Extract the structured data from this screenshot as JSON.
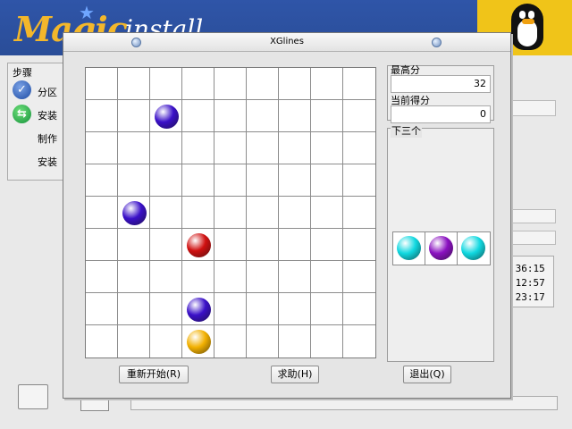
{
  "installer": {
    "logo_text": "Magic",
    "logo_rest": "install",
    "steps_title": "步骤",
    "steps": [
      {
        "label": "分区",
        "icon": "check-icon"
      },
      {
        "label": "安装",
        "icon": "arrows-icon"
      },
      {
        "label": "制作",
        "icon": ""
      },
      {
        "label": "安装",
        "icon": ""
      }
    ],
    "times": [
      ":36:15",
      ":12:57",
      ":23:17"
    ]
  },
  "dialog": {
    "title": "XGlines",
    "high_score_label": "最高分",
    "high_score": "32",
    "current_score_label": "当前得分",
    "current_score": "0",
    "next_label": "下三个",
    "buttons": {
      "restart": "重新开始(R)",
      "help": "求助(H)",
      "quit": "退出(Q)"
    }
  },
  "board": {
    "size": 9,
    "balls": [
      {
        "row": 1,
        "col": 2,
        "color": "#3a10c8"
      },
      {
        "row": 4,
        "col": 1,
        "color": "#3a10c8"
      },
      {
        "row": 5,
        "col": 3,
        "color": "#d01010"
      },
      {
        "row": 7,
        "col": 3,
        "color": "#3a10c8"
      },
      {
        "row": 8,
        "col": 3,
        "color": "#f2b000"
      }
    ]
  },
  "next_balls": [
    "#10d8e0",
    "#8a10c0",
    "#10d8e0"
  ]
}
